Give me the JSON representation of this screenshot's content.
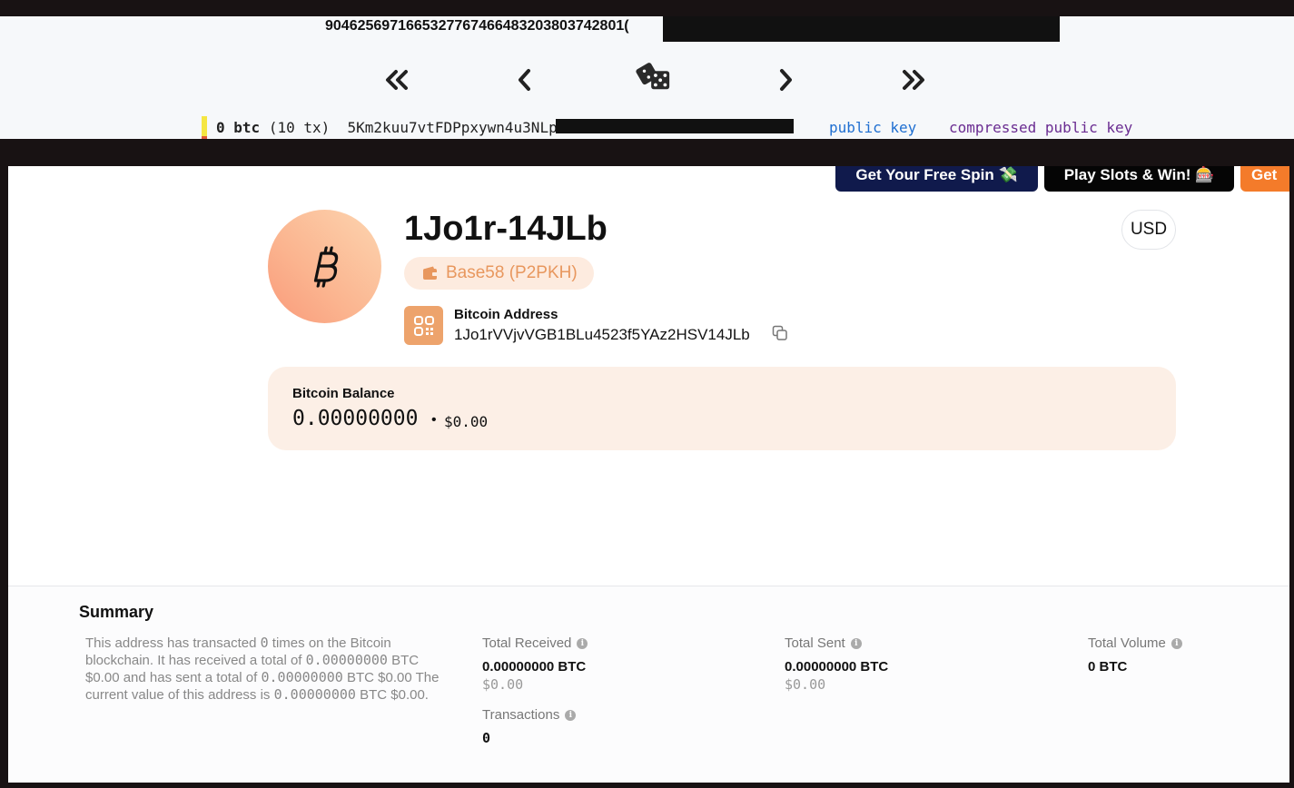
{
  "top_panel": {
    "key_number": "9046256971665327767466483203803742801(",
    "nav": {
      "first_icon": "double-chevron-left-icon",
      "prev_icon": "chevron-left-icon",
      "random_icon": "dice-icon",
      "next_icon": "chevron-right-icon",
      "last_icon": "double-chevron-right-icon"
    },
    "row": {
      "balance": "0 btc",
      "tx_count": "(10 tx)",
      "private_key": "5Km2kuu7vtFDPpxywn4u3NLp",
      "public_key_link": "public key",
      "compressed_public_key_link": "compressed public key"
    }
  },
  "promos": {
    "free_spin": "Get Your Free Spin 💸",
    "play_slots": "Play Slots & Win! 🎰",
    "get": "Get"
  },
  "address_header": {
    "title": "1Jo1r-14JLb",
    "format_tag": "Base58 (P2PKH)",
    "currency": "USD",
    "address_label": "Bitcoin Address",
    "address_value": "1Jo1rVVjvVGB1BLu4523f5YAz2HSV14JLb"
  },
  "balance": {
    "label": "Bitcoin Balance",
    "value": "0.00000000",
    "separator": "•",
    "usd": "$0.00"
  },
  "summary": {
    "title": "Summary",
    "desc_1": "This address has transacted ",
    "desc_tx": "0",
    "desc_2": " times on the Bitcoin blockchain. It has received a total of ",
    "desc_recv": "0.00000000",
    "desc_3": " BTC $0.00 and has sent a total of ",
    "desc_sent": "0.00000000",
    "desc_4": " BTC $0.00 The current value of this address is ",
    "desc_curr": "0.00000000",
    "desc_5": " BTC $0.00.",
    "total_received_label": "Total Received",
    "total_received_btc": "0.00000000 BTC",
    "total_received_usd": "$0.00",
    "total_sent_label": "Total Sent",
    "total_sent_btc": "0.00000000 BTC",
    "total_sent_usd": "$0.00",
    "total_volume_label": "Total Volume",
    "total_volume_btc": "0 BTC",
    "transactions_label": "Transactions",
    "transactions_value": "0"
  },
  "colors": {
    "accent": "#eda36c",
    "tag_text": "#e8975e",
    "balance_bg": "#fcefe6",
    "promo_navy": "#101a4c",
    "promo_orange": "#f47b2a"
  }
}
